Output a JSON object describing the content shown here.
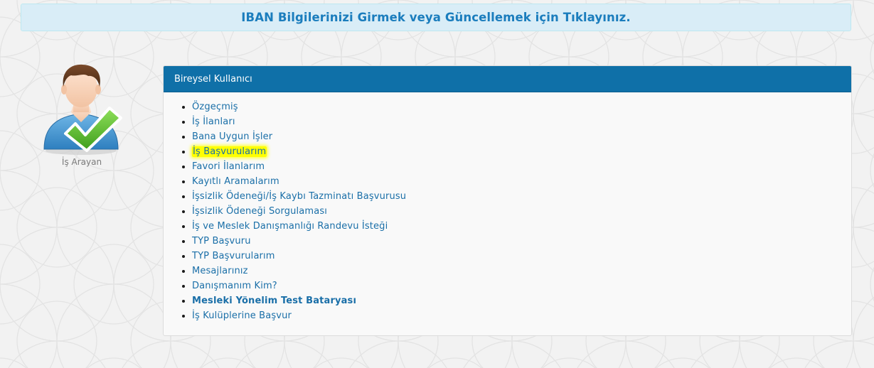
{
  "banner": {
    "text": "IBAN Bilgilerinizi Girmek veya Güncellemek için Tıklayınız."
  },
  "profile": {
    "role_label": "İş Arayan",
    "avatar_icon": "user-check-avatar-icon"
  },
  "panel": {
    "title": "Bireysel Kullanıcı",
    "menu_items": [
      {
        "label": "Özgeçmiş"
      },
      {
        "label": "İş İlanları"
      },
      {
        "label": "Bana Uygun İşler"
      },
      {
        "label": "İş Başvurularım",
        "highlighted": true
      },
      {
        "label": "Favori İlanlarım"
      },
      {
        "label": "Kayıtlı Aramalarım"
      },
      {
        "label": "İşsizlik Ödeneği/İş Kaybı Tazminatı Başvurusu"
      },
      {
        "label": "İşsizlik Ödeneği Sorgulaması"
      },
      {
        "label": "İş ve Meslek Danışmanlığı Randevu İsteği"
      },
      {
        "label": "TYP Başvuru"
      },
      {
        "label": "TYP Başvurularım"
      },
      {
        "label": "Mesajlarınız"
      },
      {
        "label": "Danışmanım Kim?"
      },
      {
        "label": "Mesleki Yönelim Test Bataryası",
        "bold": true
      },
      {
        "label": "İş Kulüplerine Başvur"
      }
    ]
  },
  "colors": {
    "header_blue": "#0f70a8",
    "link_blue": "#1a6fa8",
    "banner_bg": "#d9edf7",
    "banner_text": "#1b7dbd",
    "highlight": "#ffff00",
    "check_green": "#5cb82e"
  }
}
